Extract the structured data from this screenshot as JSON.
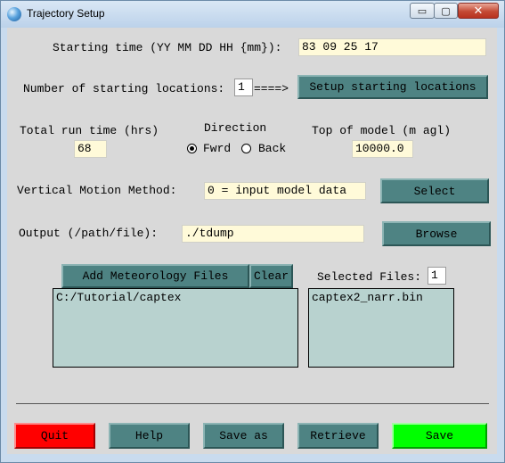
{
  "window": {
    "title": "Trajectory Setup",
    "controls": {
      "minimize": "▭",
      "maximize": "▢",
      "close": "✕"
    }
  },
  "starting_time": {
    "label": "Starting time (YY MM DD HH {mm}):",
    "value": "83 09 25 17"
  },
  "locations": {
    "label": "Number of starting locations:",
    "value": "1",
    "arrow": "====>",
    "button": "Setup starting locations"
  },
  "run_time": {
    "label": "Total run time (hrs)",
    "value": "68"
  },
  "direction": {
    "label": "Direction",
    "options": [
      {
        "label": "Fwrd",
        "selected": true
      },
      {
        "label": "Back",
        "selected": false
      }
    ]
  },
  "top_of_model": {
    "label": "Top of model (m agl)",
    "value": "10000.0"
  },
  "vertical_motion": {
    "label": "Vertical Motion Method:",
    "value": "0 = input model data",
    "button": "Select"
  },
  "output": {
    "label": "Output (/path/file):",
    "value": "./tdump",
    "button": "Browse"
  },
  "meteorology": {
    "add_button": "Add Meteorology Files",
    "clear_button": "Clear",
    "selected_label": "Selected Files:",
    "selected_count": "1",
    "directories": [
      "C:/Tutorial/captex"
    ],
    "files": [
      "captex2_narr.bin"
    ]
  },
  "footer": {
    "quit": "Quit",
    "help": "Help",
    "save_as": "Save as",
    "retrieve": "Retrieve",
    "save": "Save"
  },
  "colors": {
    "button": "#4e8383",
    "field": "#fffad9",
    "listbox": "#b8d2cf",
    "quit": "#ff0000",
    "save": "#00ff00",
    "panel": "#d9d9d9"
  }
}
